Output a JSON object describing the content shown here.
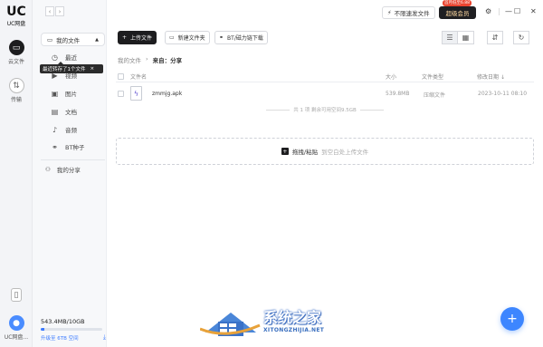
{
  "rail": {
    "logo_mark": "UC",
    "logo_text": "UC网盘",
    "cloud_label": "云文件",
    "transfer_label": "传输",
    "username": "UC网盘..."
  },
  "sidebar": {
    "my_files": "我的文件",
    "categories": [
      {
        "label": "最近",
        "icon": "clock-icon"
      },
      {
        "label": "视频",
        "icon": "video-icon"
      },
      {
        "label": "图片",
        "icon": "image-icon"
      },
      {
        "label": "文档",
        "icon": "document-icon"
      },
      {
        "label": "音频",
        "icon": "audio-icon"
      },
      {
        "label": "BT种子",
        "icon": "link-icon"
      }
    ],
    "tooltip": "最近转存了1个文件",
    "tooltip_close": "×",
    "share": "我的分享",
    "storage_used": "543.4MB/10GB",
    "storage_fraction": 0.053,
    "upgrade": "升级至 6TB 空间"
  },
  "topbar": {
    "speed_button": "不限速发文件",
    "vip_badge": "首月低至6.88",
    "vip_button": "超级会员"
  },
  "toolbar": {
    "upload": "上传文件",
    "new_folder": "新建文件夹",
    "bt_download": "BT/磁力链下载"
  },
  "breadcrumb": {
    "root": "我的文件",
    "sep": "›",
    "current": "来自：分享"
  },
  "table": {
    "headers": {
      "name": "文件名",
      "size": "大小",
      "type": "文件类型",
      "modified": "修改日期"
    },
    "sort_indicator": "↓",
    "rows": [
      {
        "name": "zmmjg.apk",
        "size": "539.8MB",
        "type": "压缩文件",
        "modified": "2023-10-11 08:10"
      }
    ],
    "footnote": "共 1 项 剩余可用空间9.5GB"
  },
  "dropzone": {
    "action": "拖拽/粘贴",
    "hint": "到空白处上传文件"
  },
  "watermark": {
    "title": "系统之家",
    "subtitle": "XITONGZHIJIA.NET"
  }
}
